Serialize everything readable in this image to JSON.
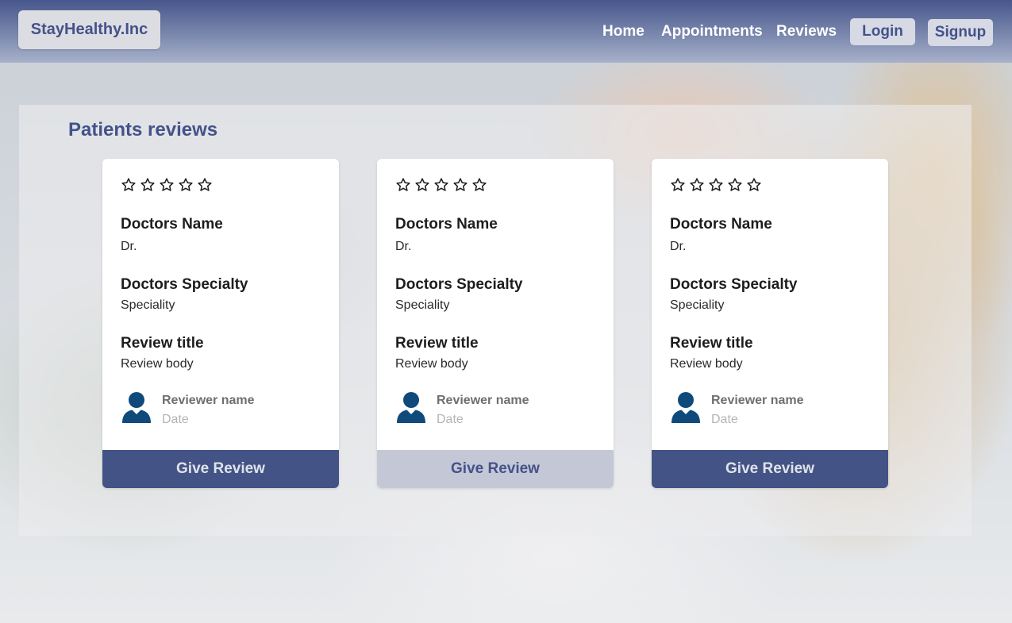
{
  "brand": "StayHealthy.Inc",
  "nav": {
    "home": "Home",
    "appointments": "Appointments",
    "reviews": "Reviews",
    "login": "Login",
    "signup": "Signup"
  },
  "section_title": "Patients reviews",
  "cards": [
    {
      "rating": 0,
      "max_rating": 5,
      "doctor_name_label": "Doctors Name",
      "doctor_name_value": "Dr.",
      "specialty_label": "Doctors Specialty",
      "specialty_value": "Speciality",
      "review_title": "Review title",
      "review_body": "Review body",
      "reviewer_name": "Reviewer name",
      "date": "Date",
      "button_label": "Give Review"
    },
    {
      "rating": 0,
      "max_rating": 5,
      "doctor_name_label": "Doctors Name",
      "doctor_name_value": "Dr.",
      "specialty_label": "Doctors Specialty",
      "specialty_value": "Speciality",
      "review_title": "Review title",
      "review_body": "Review body",
      "reviewer_name": "Reviewer name",
      "date": "Date",
      "button_label": "Give Review"
    },
    {
      "rating": 0,
      "max_rating": 5,
      "doctor_name_label": "Doctors Name",
      "doctor_name_value": "Dr.",
      "specialty_label": "Doctors Specialty",
      "specialty_value": "Speciality",
      "review_title": "Review title",
      "review_body": "Review body",
      "reviewer_name": "Reviewer name",
      "date": "Date",
      "button_label": "Give Review"
    }
  ],
  "icons": {
    "star": "star-outline-icon",
    "avatar": "user-avatar-icon"
  },
  "colors": {
    "brand": "#44528a",
    "button": "#435385",
    "button_hover": "#c4c8d6",
    "avatar": "#0f4a7a"
  }
}
